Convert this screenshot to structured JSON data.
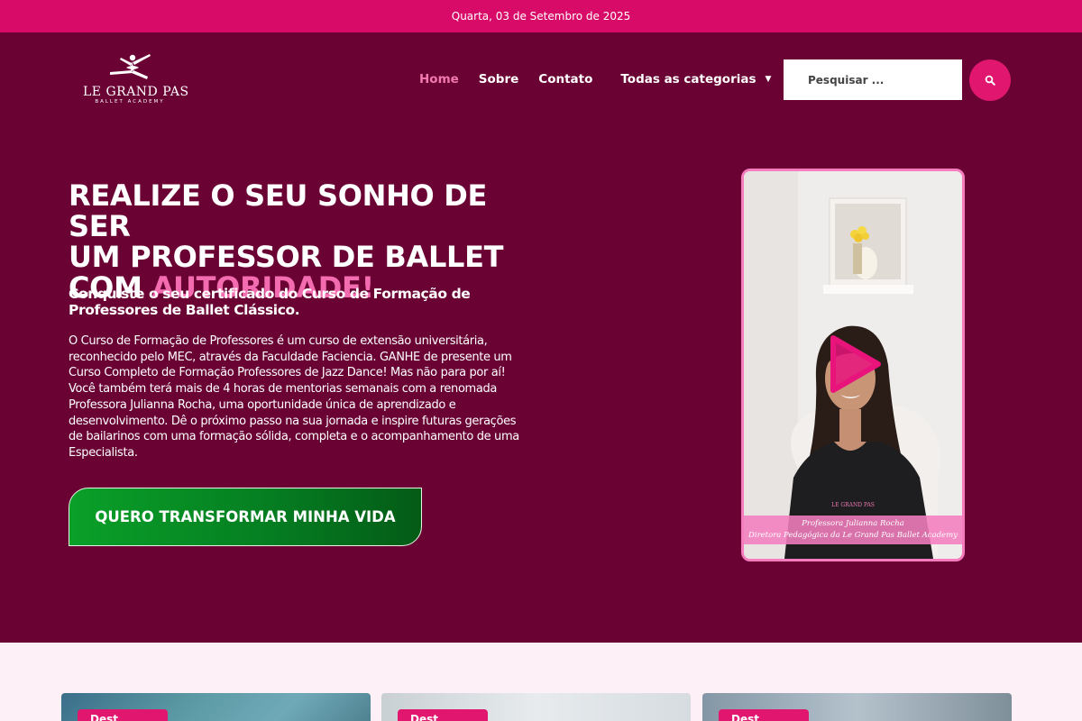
{
  "topbar": {
    "date": "Quarta, 03 de Setembro de 2025"
  },
  "logo": {
    "name": "LE GRAND PAS",
    "subtitle": "BALLET ACADEMY"
  },
  "nav": {
    "items": [
      {
        "label": "Home",
        "active": true
      },
      {
        "label": "Sobre",
        "active": false
      },
      {
        "label": "Contato",
        "active": false
      }
    ],
    "categories_label": "Todas as categorias"
  },
  "search": {
    "placeholder": "Pesquisar ...",
    "icon": "search-icon"
  },
  "hero": {
    "headline_line1": "REALIZE O SEU SONHO DE SER",
    "headline_line2": "UM PROFESSOR DE BALLET",
    "headline_line3_prefix": "COM ",
    "headline_highlight": "AUTORIDADE!",
    "subheadline": "Conquiste o seu certificado do Curso de Formação de Professores de Ballet Clássico.",
    "body": "O Curso de Formação de Professores é um curso de extensão universitária, reconhecido pelo MEC, através da Faculdade Faciencia. GANHE de presente um Curso Completo de Formação Professores de Jazz Dance! Mas não para por aí! Você também terá mais de 4 horas de mentorias semanais com a renomada Professora Julianna Rocha, uma oportunidade única de aprendizado e desenvolvimento. Dê o próximo passo na sua jornada e inspire futuras gerações de bailarinos com uma formação sólida, completa e o acompanhamento de uma Especialista.",
    "cta_label": "QUERO TRANSFORMAR MINHA VIDA"
  },
  "video": {
    "caption_line1": "Professora Julianna Rocha",
    "caption_line2": "Diretora Pedagógica da Le Grand Pas Ballet Academy",
    "shirt_logo": "LE GRAND PAS"
  },
  "cards": [
    {
      "tag": "Dest"
    },
    {
      "tag": "Dest"
    },
    {
      "tag": "Dest"
    }
  ],
  "colors": {
    "topbar": "#d90b68",
    "hero_background": "#6a0234",
    "accent_pink": "#f36cb0",
    "cta_green": "#0aa028"
  }
}
